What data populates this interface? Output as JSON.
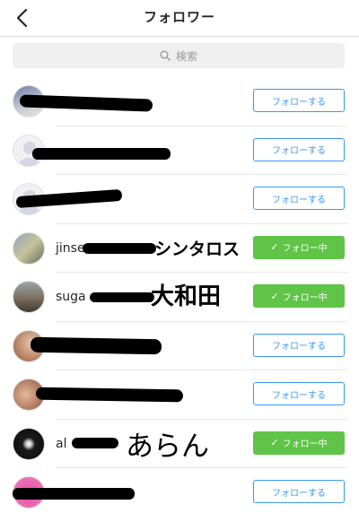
{
  "header": {
    "title": "フォロワー"
  },
  "search": {
    "placeholder": "検索"
  },
  "rows": [
    {
      "username": "",
      "button": "フォローする",
      "following": false
    },
    {
      "username": "",
      "button": "フォローする",
      "following": false
    },
    {
      "username": "",
      "button": "フォローする",
      "following": false
    },
    {
      "username": "jinse",
      "annotation": "シンタロス",
      "button": "フォロー中",
      "following": true
    },
    {
      "username": "suga",
      "annotation": "大和田",
      "button": "フォロー中",
      "following": true
    },
    {
      "username": "",
      "button": "フォローする",
      "following": false
    },
    {
      "username": "",
      "button": "フォローする",
      "following": false
    },
    {
      "username": "al",
      "annotation": "あらん",
      "button": "フォロー中",
      "following": true
    },
    {
      "username": "",
      "button": "フォローする",
      "following": false
    }
  ],
  "colors": {
    "follow_blue": "#3897f0",
    "following_green": "#5fc447"
  }
}
